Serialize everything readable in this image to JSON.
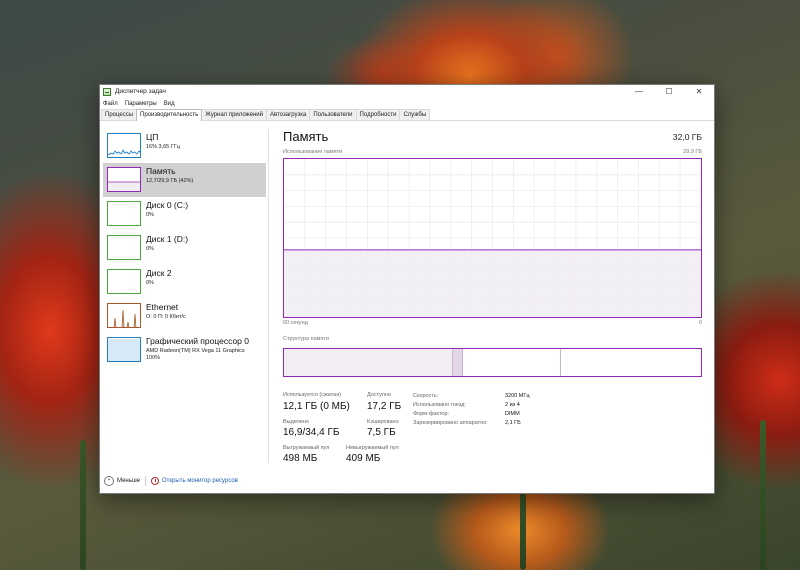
{
  "window": {
    "title": "Диспетчер задач",
    "controls": {
      "minimize": "—",
      "maximize": "☐",
      "close": "✕"
    }
  },
  "menu": [
    "Файл",
    "Параметры",
    "Вид"
  ],
  "tabs": [
    {
      "label": "Процессы",
      "active": false
    },
    {
      "label": "Производительность",
      "active": true
    },
    {
      "label": "Журнал приложений",
      "active": false
    },
    {
      "label": "Автозагрузка",
      "active": false
    },
    {
      "label": "Пользователи",
      "active": false
    },
    {
      "label": "Подробности",
      "active": false
    },
    {
      "label": "Службы",
      "active": false
    }
  ],
  "sidebar": [
    {
      "title": "ЦП",
      "sub": "16% 3,65 ГГц",
      "color": "#1f7fc1",
      "icon": "cpu-graph"
    },
    {
      "title": "Память",
      "sub": "12,7/29,9 ГБ (42%)",
      "color": "#9528b4",
      "icon": "memory-graph",
      "active": true
    },
    {
      "title": "Диск 0 (C:)",
      "sub": "0%",
      "color": "#4ba83c",
      "icon": "disk-graph"
    },
    {
      "title": "Диск 1 (D:)",
      "sub": "0%",
      "color": "#4ba83c",
      "icon": "disk-graph"
    },
    {
      "title": "Диск 2",
      "sub": "0%",
      "color": "#4ba83c",
      "icon": "disk-graph"
    },
    {
      "title": "Ethernet",
      "sub": "О: 0 П: 0 Кбит/с",
      "color": "#a7572b",
      "icon": "network-graph"
    },
    {
      "title": "Графический процессор 0",
      "sub": "AMD Radeon(TM) RX Vega 11 Graphics",
      "sub2": "100%",
      "color": "#1f7fc1",
      "icon": "gpu-graph"
    }
  ],
  "main": {
    "title": "Память",
    "total": "32,0 ГБ",
    "usage_label": "Использование памяти",
    "usage_max": "29,9 ГБ",
    "axis_left": "60 секунд",
    "axis_right": "0",
    "usage_fraction": 0.425,
    "composition_label": "Структура памяти",
    "composition": [
      {
        "kind": "in-use",
        "fraction": 0.405
      },
      {
        "kind": "modified",
        "fraction": 0.025
      },
      {
        "kind": "standby",
        "fraction": 0.235
      },
      {
        "kind": "free",
        "fraction": 0.335
      }
    ],
    "stats": {
      "in_use_label": "Используется (сжатая)",
      "in_use_value": "12,1 ГБ (0 МБ)",
      "available_label": "Доступно",
      "available_value": "17,2 ГБ",
      "committed_label": "Выделено",
      "committed_value": "16,9/34,4 ГБ",
      "cached_label": "Кэшировано",
      "cached_value": "7,5 ГБ",
      "paged_label": "Выгружаемый пул",
      "paged_value": "498 МБ",
      "nonpaged_label": "Невыгружаемый пул",
      "nonpaged_value": "409 МБ"
    },
    "details": [
      {
        "label": "Скорость:",
        "value": "3200 МГц"
      },
      {
        "label": "Использовано гнезд:",
        "value": "2 из 4"
      },
      {
        "label": "Форм-фактор:",
        "value": "DIMM"
      },
      {
        "label": "Зарезервировано аппаратно:",
        "value": "2,1 ГБ"
      }
    ]
  },
  "footer": {
    "fewer": "Меньше",
    "monitor": "Открыть монитор ресурсов"
  },
  "colors": {
    "memory": "#9528b4",
    "memory_fill": "#f1edf3"
  }
}
